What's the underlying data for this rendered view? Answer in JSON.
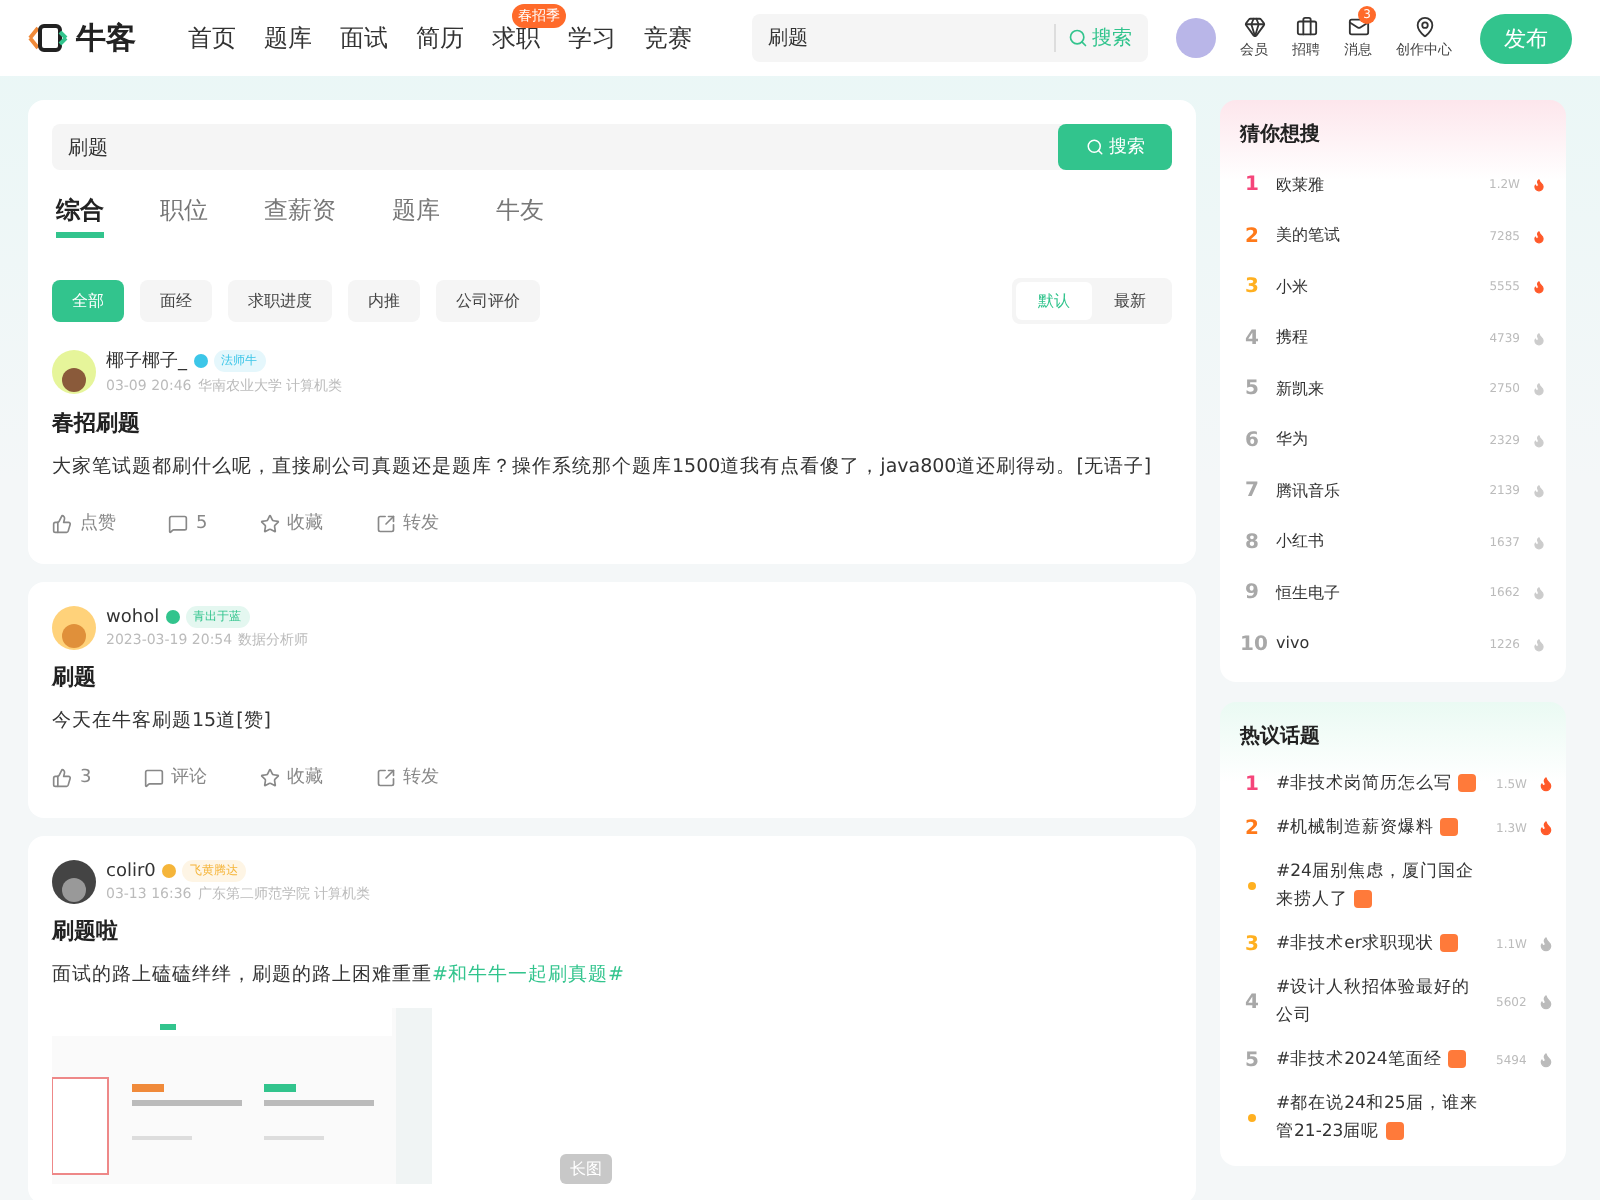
{
  "header": {
    "logo": "牛客",
    "nav": [
      {
        "label": "首页"
      },
      {
        "label": "题库"
      },
      {
        "label": "面试"
      },
      {
        "label": "简历"
      },
      {
        "label": "求职",
        "badge": "春招季"
      },
      {
        "label": "学习"
      },
      {
        "label": "竞赛"
      }
    ],
    "search": {
      "value": "刷题",
      "button": "搜索"
    },
    "tools": [
      {
        "kind": "vip",
        "label": "会员"
      },
      {
        "kind": "job",
        "label": "招聘"
      },
      {
        "kind": "mail",
        "label": "消息",
        "badge": "3"
      },
      {
        "kind": "pin",
        "label": "创作中心"
      }
    ],
    "publish": "发布"
  },
  "search_panel": {
    "value": "刷题",
    "button": "搜索",
    "tabs": [
      {
        "label": "综合",
        "selected": true
      },
      {
        "label": "职位",
        "selected": false
      },
      {
        "label": "查薪资",
        "selected": false
      },
      {
        "label": "题库",
        "selected": false
      },
      {
        "label": "牛友",
        "selected": false
      }
    ],
    "filters": [
      {
        "label": "全部",
        "selected": true
      },
      {
        "label": "面经",
        "selected": false
      },
      {
        "label": "求职进度",
        "selected": false
      },
      {
        "label": "内推",
        "selected": false
      },
      {
        "label": "公司评价",
        "selected": false
      }
    ],
    "sort": [
      {
        "label": "默认",
        "selected": true
      },
      {
        "label": "最新",
        "selected": false
      }
    ]
  },
  "posts": [
    {
      "author": "椰子椰子_",
      "badge": {
        "label": "法师牛",
        "color": "#3cc6e8"
      },
      "time": "03-09 20:46",
      "meta": "华南农业大学 计算机类",
      "title": "春招刷题",
      "body": "大家笔试题都刷什么呢，直接刷公司真题还是题库？操作系统那个题库1500道我有点看傻了，java800道还刷得动。[无语子]",
      "actions": [
        "点赞",
        "5",
        "收藏",
        "转发"
      ]
    },
    {
      "author": "wohol",
      "badge": {
        "label": "青出于蓝",
        "color": "#32c48d"
      },
      "time": "2023-03-19 20:54",
      "meta": "数据分析师",
      "title": "刷题",
      "body": "今天在牛客刷题15道[赞]",
      "actions": [
        "3",
        "评论",
        "收藏",
        "转发"
      ]
    },
    {
      "author": "colir0",
      "badge": {
        "label": "飞黄腾达",
        "color": "#f5b53a"
      },
      "time": "03-13 16:36",
      "meta": "广东第二师范学院 计算机类",
      "title": "刷题啦",
      "body": "面试的路上磕磕绊绊，刷题的路上困难重重",
      "topic": "#和牛牛一起刷真题#",
      "image": {
        "kind": "picture",
        "tag": "长图"
      }
    }
  ],
  "guess": {
    "title": "猜你想搜",
    "items": [
      {
        "rank": "1",
        "color": "#f5457a",
        "name": "欧莱雅",
        "count": "1.2W",
        "hot": true
      },
      {
        "rank": "2",
        "color": "#ff7a1a",
        "name": "美的笔试",
        "count": "7285",
        "hot": true
      },
      {
        "rank": "3",
        "color": "#ffb020",
        "name": "小米",
        "count": "5555",
        "hot": true
      },
      {
        "rank": "4",
        "color": "#a8a8a8",
        "name": "携程",
        "count": "4739",
        "hot": false
      },
      {
        "rank": "5",
        "color": "#a8a8a8",
        "name": "新凯来",
        "count": "2750",
        "hot": false
      },
      {
        "rank": "6",
        "color": "#a8a8a8",
        "name": "华为",
        "count": "2329",
        "hot": false
      },
      {
        "rank": "7",
        "color": "#a8a8a8",
        "name": "腾讯音乐",
        "count": "2139",
        "hot": false
      },
      {
        "rank": "8",
        "color": "#a8a8a8",
        "name": "小红书",
        "count": "1637",
        "hot": false
      },
      {
        "rank": "9",
        "color": "#a8a8a8",
        "name": "恒生电子",
        "count": "1662",
        "hot": false
      },
      {
        "rank": "10",
        "color": "#a8a8a8",
        "name": "vivo",
        "count": "1226",
        "hot": false
      }
    ]
  },
  "topics": {
    "title": "热议话题",
    "items": [
      {
        "kind": "rank",
        "rank": "1",
        "color": "#f5457a",
        "name": "#非技术岗简历怎么写",
        "tag": true,
        "count": "1.5W",
        "hot": true
      },
      {
        "kind": "rank",
        "rank": "2",
        "color": "#ff7a1a",
        "name": "#机械制造薪资爆料",
        "tag": true,
        "count": "1.3W",
        "hot": true
      },
      {
        "kind": "dot",
        "color": "#ffb020",
        "name": "#24届别焦虑，厦门国企来捞人了",
        "tag": true
      },
      {
        "kind": "rank",
        "rank": "3",
        "color": "#ffb020",
        "name": "#非技术er求职现状",
        "tag": true,
        "count": "1.1W",
        "hot": false
      },
      {
        "kind": "rank",
        "rank": "4",
        "color": "#a8a8a8",
        "name": "#设计人秋招体验最好的公司",
        "tag": false,
        "count": "5602",
        "hot": false
      },
      {
        "kind": "rank",
        "rank": "5",
        "color": "#a8a8a8",
        "name": "#非技术2024笔面经",
        "tag": true,
        "count": "5494",
        "hot": false
      },
      {
        "kind": "dot",
        "color": "#ffb020",
        "name": "#都在说24和25届，谁来管21-23届呢",
        "tag": true
      }
    ]
  }
}
